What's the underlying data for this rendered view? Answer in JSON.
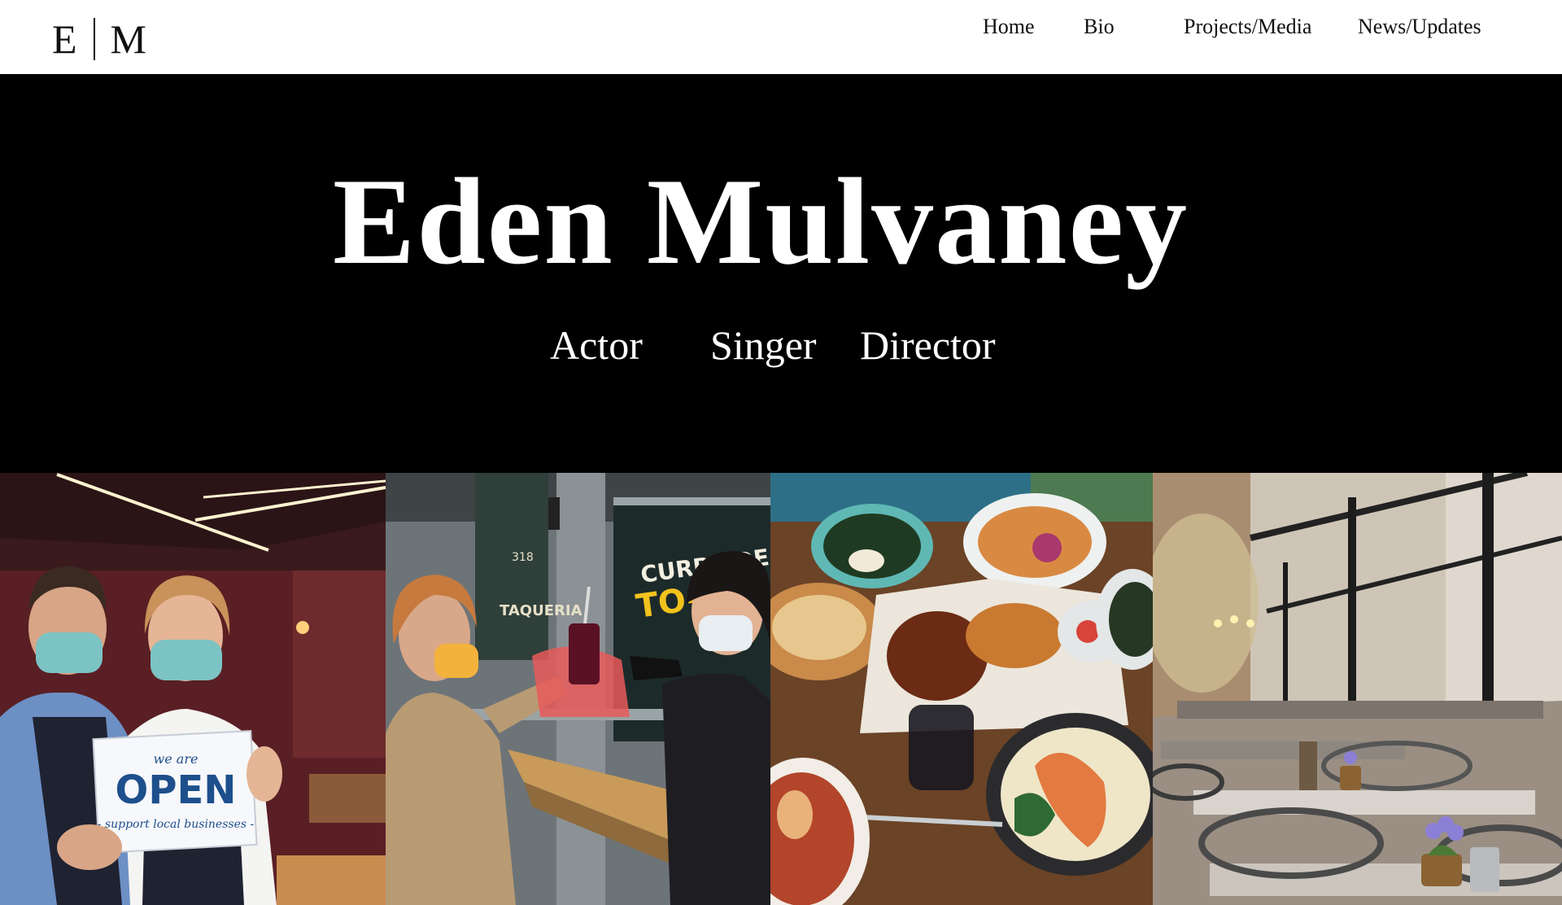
{
  "logo": {
    "left": "E",
    "right": "M"
  },
  "nav": {
    "home": "Home",
    "bio": "Bio",
    "projects": "Projects/Media",
    "news": "News/Updates"
  },
  "hero": {
    "name": "Eden Mulvaney",
    "roles": [
      "Actor",
      "Singer",
      "Director"
    ]
  },
  "gallery": {
    "sign": {
      "line1": "we are",
      "line2": "OPEN",
      "line3": "- support local businesses -"
    },
    "storefront": {
      "line1": "CURBSIDE PICKUP",
      "line2": "TO-GO",
      "side_sign": "TAQUERIA",
      "address": "318"
    }
  },
  "colors": {
    "header_bg": "#ffffff",
    "hero_bg": "#000000",
    "hero_text": "#ffffff",
    "nav_text": "#111111",
    "sign_blue": "#1d4f8c",
    "to_go_yellow": "#f2c21d"
  }
}
